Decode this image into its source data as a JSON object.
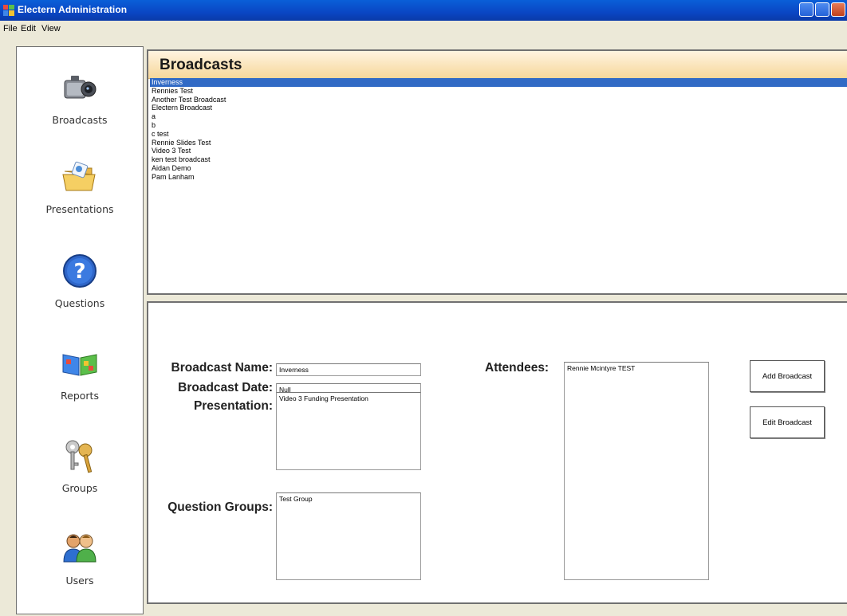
{
  "window": {
    "title": "Electern Administration"
  },
  "menu": {
    "file": "File",
    "edit": "Edit",
    "view": "View"
  },
  "nav": {
    "broadcasts": "Broadcasts",
    "presentations": "Presentations",
    "questions": "Questions",
    "reports": "Reports",
    "groups": "Groups",
    "users": "Users"
  },
  "broadcasts": {
    "title": "Broadcasts",
    "items": [
      "Inverness",
      "Rennies Test",
      "Another Test Broadcast",
      "Electern Broadcast",
      "a",
      "b",
      "c test",
      "Rennie Slides Test",
      "Video 3 Test",
      "ken test broadcast",
      "Aidan Demo",
      "Pam Lanham"
    ],
    "selected_index": 0
  },
  "details": {
    "name_label": "Broadcast Name:",
    "name_value": "Inverness",
    "date_label": "Broadcast Date:",
    "date_value": "Null",
    "presentation_label": "Presentation:",
    "presentation_value": "Video 3 Funding Presentation",
    "question_groups_label": "Question Groups:",
    "question_groups_value": "Test Group",
    "attendees_label": "Attendees:",
    "attendees_value": "Rennie Mcintyre TEST",
    "add_button": "Add Broadcast",
    "edit_button": "Edit Broadcast"
  },
  "colors": {
    "titlebar": "#0a46c4",
    "selection": "#316ac5",
    "header_gradient_end": "#f6d79b",
    "window_bg": "#ece9d8"
  }
}
